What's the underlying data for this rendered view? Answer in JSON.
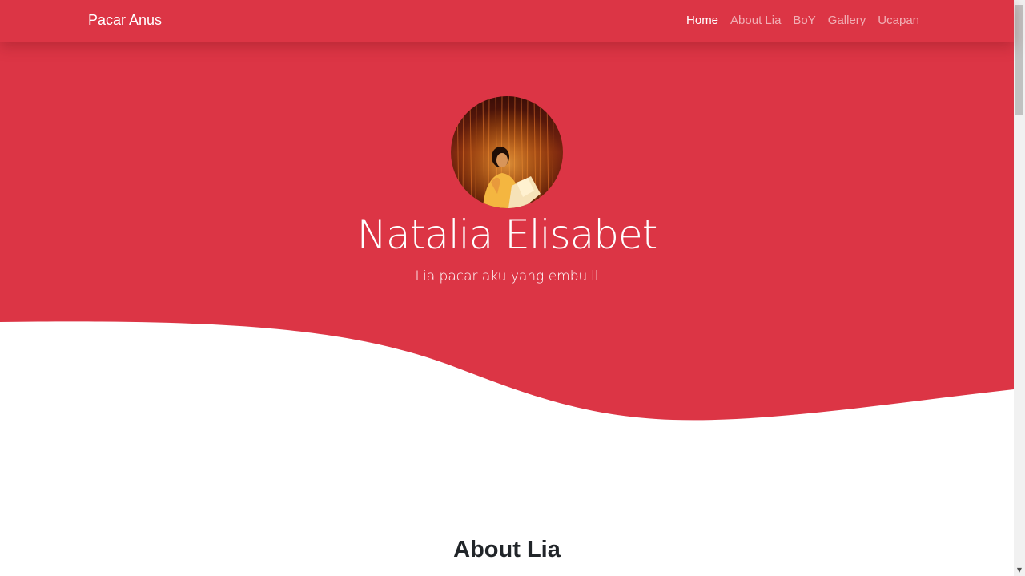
{
  "navbar": {
    "brand": "Pacar Anus",
    "links": [
      {
        "label": "Home",
        "active": true
      },
      {
        "label": "About Lia",
        "active": false
      },
      {
        "label": "BoY",
        "active": false
      },
      {
        "label": "Gallery",
        "active": false
      },
      {
        "label": "Ucapan",
        "active": false
      }
    ]
  },
  "hero": {
    "title": "Natalia Elisabet",
    "subtitle": "Lia pacar aku yang embulll"
  },
  "about": {
    "title": "About Lia"
  },
  "colors": {
    "primary": "#dc3545",
    "text_dark": "#212529",
    "background": "#ffffff"
  }
}
